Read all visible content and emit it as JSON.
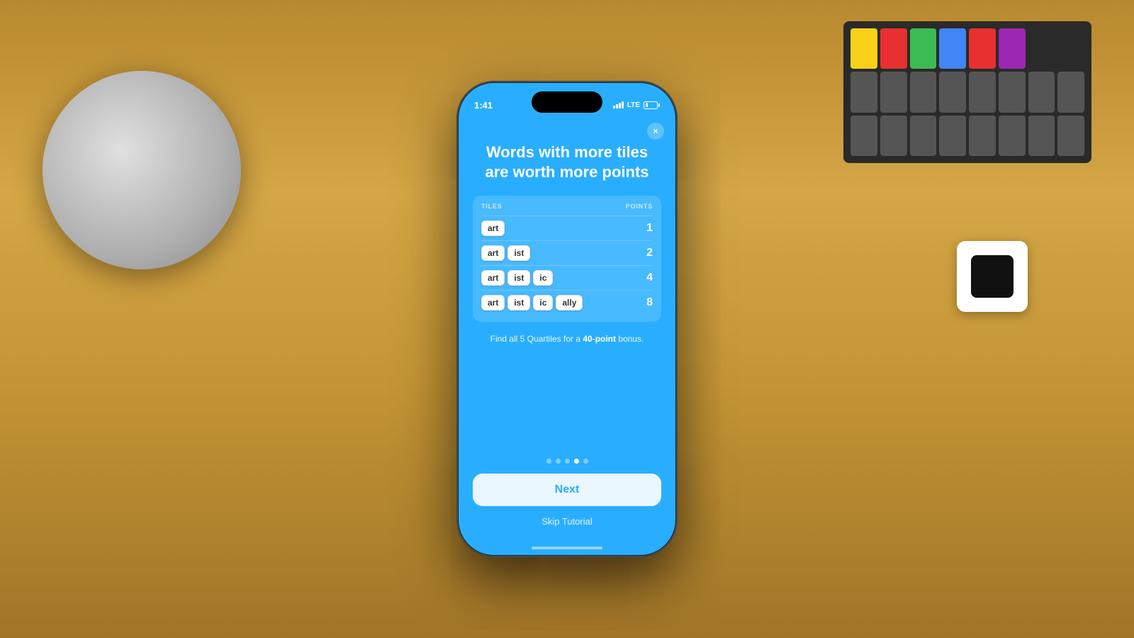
{
  "background": {
    "color": "#c49535"
  },
  "phone": {
    "statusBar": {
      "time": "1:41",
      "lte": "LTE"
    },
    "closeButton": "×",
    "heading": "Words with more tiles are worth more points",
    "table": {
      "colTiles": "TILES",
      "colPoints": "POINTS",
      "rows": [
        {
          "tiles": [
            "art"
          ],
          "points": "1"
        },
        {
          "tiles": [
            "art",
            "ist"
          ],
          "points": "2"
        },
        {
          "tiles": [
            "art",
            "ist",
            "ic"
          ],
          "points": "4"
        },
        {
          "tiles": [
            "art",
            "ist",
            "ic",
            "ally"
          ],
          "points": "8"
        }
      ]
    },
    "bonusText": "Find all 5 Quartiles for a ",
    "bonusHighlight": "40-point",
    "bonusSuffix": " bonus.",
    "pagination": {
      "dots": 5,
      "activeIndex": 3
    },
    "nextButton": "Next",
    "skipButton": "Skip Tutorial"
  }
}
